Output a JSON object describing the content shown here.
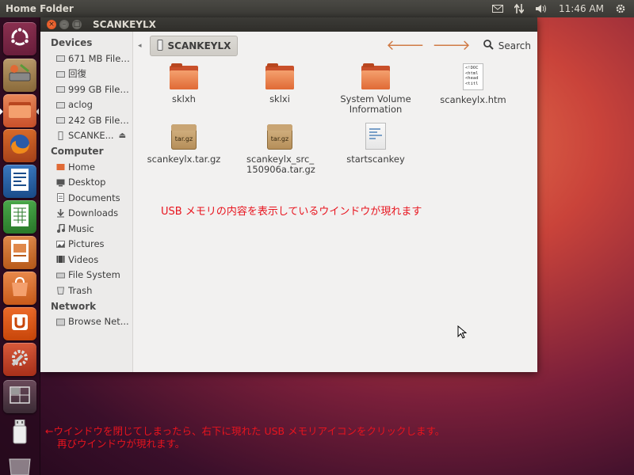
{
  "top_panel": {
    "app_title": "Home Folder",
    "clock": "11:46 AM"
  },
  "launcher": {
    "items": [
      {
        "name": "dash-home",
        "icon": "ubuntu-logo-icon"
      },
      {
        "name": "hard-drive",
        "icon": "drive-icon"
      },
      {
        "name": "files",
        "icon": "folder-icon"
      },
      {
        "name": "firefox",
        "icon": "firefox-icon"
      },
      {
        "name": "writer",
        "icon": "writer-icon"
      },
      {
        "name": "calc",
        "icon": "calc-icon"
      },
      {
        "name": "impress",
        "icon": "impress-icon"
      },
      {
        "name": "software-center",
        "icon": "shopping-bag-icon"
      },
      {
        "name": "ubuntu-one",
        "icon": "ubuntu-one-icon"
      },
      {
        "name": "system-settings",
        "icon": "settings-icon"
      },
      {
        "name": "workspace-switcher",
        "icon": "workspace-icon"
      },
      {
        "name": "usb-drive",
        "icon": "usb-icon"
      },
      {
        "name": "trash",
        "icon": "trash-icon"
      }
    ]
  },
  "window": {
    "title": "SCANKEYLX",
    "close_glyph": "×",
    "min_glyph": "–",
    "max_glyph": "□"
  },
  "sidebar": {
    "devices_heading": "Devices",
    "devices": [
      "671 MB Files...",
      "回復",
      "999 GB Files...",
      "aclog",
      "242 GB Files...",
      "SCANKE..."
    ],
    "computer_heading": "Computer",
    "computer": [
      "Home",
      "Desktop",
      "Documents",
      "Downloads",
      "Music",
      "Pictures",
      "Videos",
      "File System",
      "Trash"
    ],
    "network_heading": "Network",
    "network": [
      "Browse Net..."
    ]
  },
  "toolbar": {
    "path_label": "SCANKEYLX",
    "search_label": "Search"
  },
  "files": [
    {
      "name": "sklxh",
      "type": "folder"
    },
    {
      "name": "sklxi",
      "type": "folder"
    },
    {
      "name": "System Volume Information",
      "type": "folder"
    },
    {
      "name": "scankeylx.htm",
      "type": "html"
    },
    {
      "name": "scankeylx.tar.gz",
      "type": "archive",
      "badge": "tar.gz"
    },
    {
      "name": "scankeylx_src_ 150906a.tar.gz",
      "type": "archive",
      "badge": "tar.gz"
    },
    {
      "name": "startscankey",
      "type": "script"
    }
  ],
  "html_preview_lines": [
    "<!DOC",
    "<html",
    "<head",
    "<titl"
  ],
  "annotations": {
    "window_note": "USB メモリの内容を表示しているウインドウが現れます",
    "bottom_line1": "←ウインドウを閉じてしまったら、右下に現れた USB メモリアイコンをクリックします。",
    "bottom_line2": "再びウインドウが現れます。"
  },
  "colors": {
    "annotation": "#e8141e",
    "folder": "#e06a35",
    "accent_orange": "#df4a16"
  }
}
